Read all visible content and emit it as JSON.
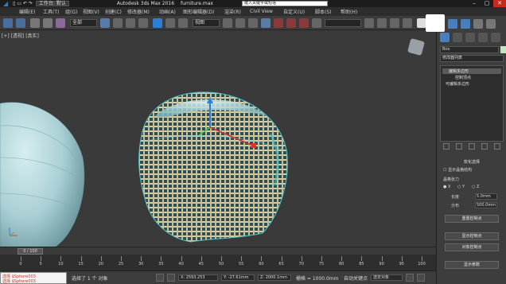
{
  "title_bar": {
    "tabs": [
      "工作台: 默认",
      "Autodesk 3ds Max 2016",
      "furniture.max"
    ],
    "search_placeholder": "键入关键字或短语"
  },
  "menu": {
    "items": [
      "编辑(E)",
      "工具(T)",
      "组(G)",
      "视图(V)",
      "创建(C)",
      "修改器(M)",
      "动画(A)",
      "图形编辑器(D)",
      "渲染(R)",
      "Civil View",
      "自定义(U)",
      "脚本(S)",
      "帮助(H)"
    ]
  },
  "toolbar": {
    "selection_filter": "全部",
    "reference_coord": "视图"
  },
  "viewport": {
    "label": "[+] [透视] [真实]"
  },
  "command_panel": {
    "object_name": "Box",
    "modifier_list": "修改器列表",
    "stack_items": [
      "编辑多边形",
      "控制顶点",
      "可编辑多边形"
    ],
    "rollout_title": "软化选择",
    "checkbox_label": "显示晶格结构",
    "tension_label": "晶格张力",
    "axis_labels": [
      "X",
      "Y",
      "Z"
    ],
    "width_label": "长度",
    "width_value": "5.0mm",
    "length_label": "分布",
    "length_value": "500.0mm",
    "buttons": [
      "重置控制点",
      "显示控制点",
      "对象控制点",
      "显示参数"
    ]
  },
  "timeline": {
    "slider_label": "0 / 100",
    "ticks": [
      "0",
      "5",
      "10",
      "15",
      "20",
      "25",
      "30",
      "35",
      "40",
      "45",
      "50",
      "55",
      "60",
      "65",
      "70",
      "75",
      "80",
      "85",
      "90",
      "95",
      "100"
    ]
  },
  "status": {
    "maxscript_lines": [
      "选择 $Sphere003",
      "选择 $Sphere003"
    ],
    "selection_text": "选择了 1 个 对象",
    "x_field": "X: 2593.253",
    "y_field": "Y: -27.61mm",
    "z_field": "Z: 2000.1mm",
    "grid_field": "栅格 = 1000.0mm",
    "autokey_label": "自动关键点",
    "selected_dropdown": "选定对象"
  },
  "colors": {
    "accent": "#2d7fd6",
    "sphere": "#a9cfd4",
    "lattice": "#d8cfa8"
  }
}
